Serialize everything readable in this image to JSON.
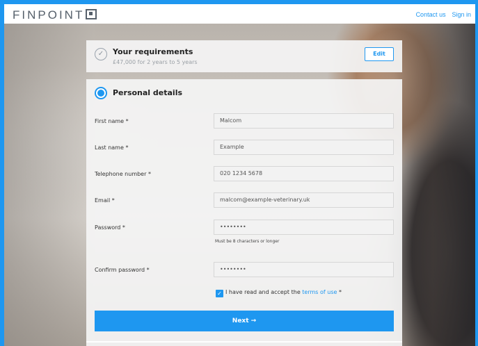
{
  "header": {
    "logo_text": "FINPOINT",
    "links": [
      "Contact us",
      "Sign in"
    ]
  },
  "requirements": {
    "title": "Your requirements",
    "subtitle": "£47,000 for 2 years to 5 years",
    "edit_label": "Edit"
  },
  "personal": {
    "title": "Personal details",
    "fields": [
      {
        "label": "First name *",
        "value": "Malcom"
      },
      {
        "label": "Last name *",
        "value": "Example"
      },
      {
        "label": "Telephone number *",
        "value": "020 1234 5678"
      },
      {
        "label": "Email *",
        "value": "malcom@example-veterinary.uk"
      },
      {
        "label": "Password *",
        "value": "••••••••"
      },
      {
        "label": "Confirm password *",
        "value": "••••••••"
      }
    ],
    "password_hint": "Must be 8 characters or longer",
    "terms_prefix": "I have read and accept the",
    "terms_link": "terms of use",
    "terms_suffix": "*",
    "terms_checked": true,
    "next_label": "Next →"
  },
  "colors": {
    "accent": "#1e97f0"
  }
}
